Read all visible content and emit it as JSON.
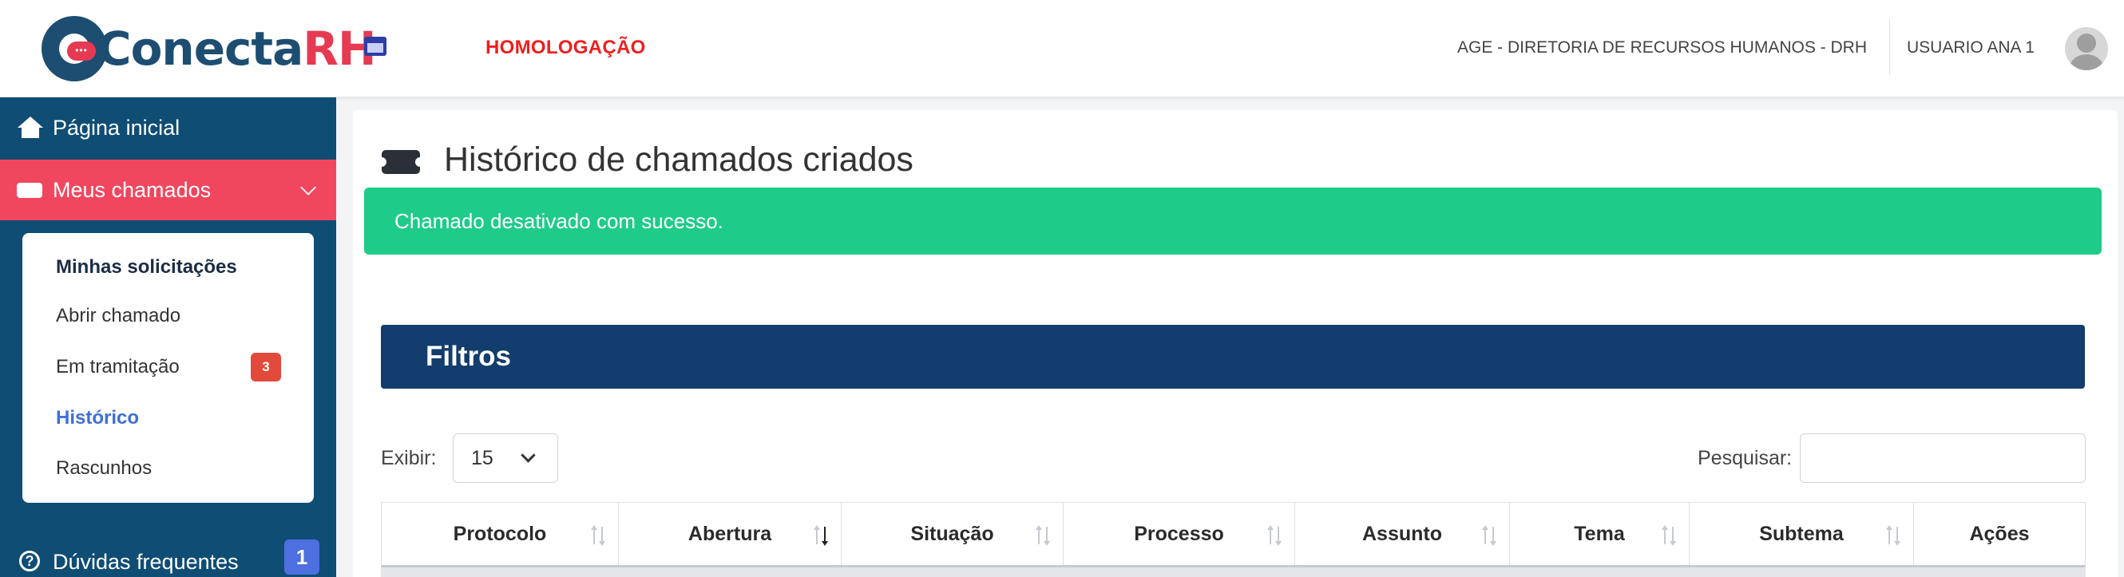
{
  "header": {
    "logo_text": "Conecta",
    "logo_rh": "RH",
    "environment": "HOMOLOGAÇÃO",
    "organization": "AGE - DIRETORIA DE RECURSOS HUMANOS - DRH",
    "user_name": "USUARIO ANA 1",
    "icons": {
      "window": "window-icon",
      "avatar": "user-avatar"
    },
    "colors": {
      "environment": "#f01e1e"
    }
  },
  "sidebar": {
    "home": "Página inicial",
    "meus_chamados": "Meus chamados",
    "submenu": {
      "minhas": "Minhas solicitações",
      "abrir": "Abrir chamado",
      "tramitacao": "Em tramitação",
      "tramitacao_count": "3",
      "historico": "Histórico",
      "rascunhos": "Rascunhos"
    },
    "duvidas": "Dúvidas frequentes",
    "duvidas_count": "1",
    "colors": {
      "background": "#0f4d74",
      "active": "#f0475f"
    }
  },
  "main": {
    "title": "Histórico de chamados criados",
    "alert": "Chamado desativado com sucesso.",
    "filters_title": "Filtros",
    "exibir_label": "Exibir:",
    "exibir_value": "15",
    "pesquisar_label": "Pesquisar:",
    "pesquisar_value": "",
    "columns": [
      "Protocolo",
      "Abertura",
      "Situação",
      "Processo",
      "Assunto",
      "Tema",
      "Subtema",
      "Ações"
    ],
    "sorted_column": "Abertura",
    "colors": {
      "alert": "#1ecb89",
      "filters": "#123d6d"
    }
  }
}
